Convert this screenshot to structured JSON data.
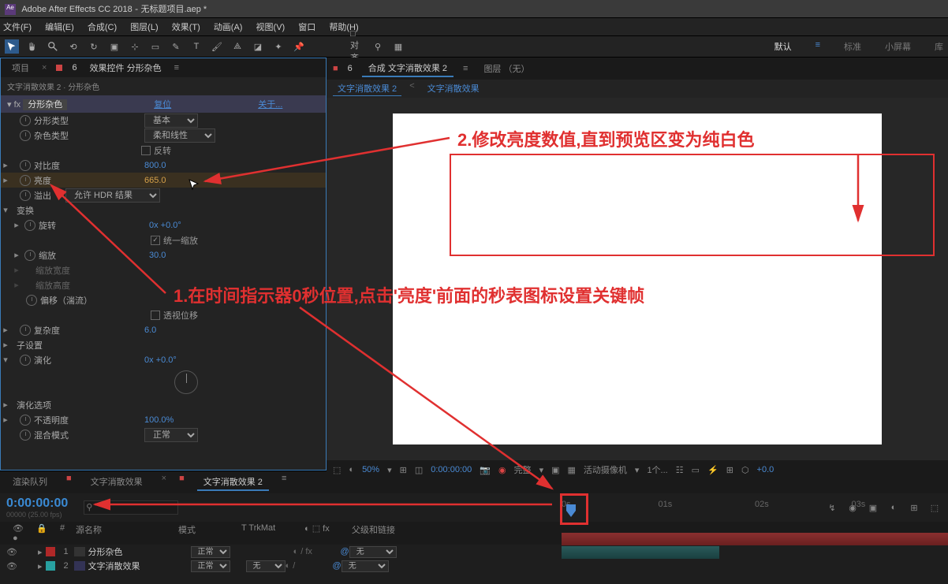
{
  "titlebar": {
    "app": "Adobe After Effects CC 2018",
    "project": "无标题项目.aep *"
  },
  "menu": [
    "文件(F)",
    "编辑(E)",
    "合成(C)",
    "图层(L)",
    "效果(T)",
    "动画(A)",
    "视图(V)",
    "窗口",
    "帮助(H)"
  ],
  "toolbar": {
    "snap": "□ 对齐"
  },
  "workspaces": [
    "默认",
    "标准",
    "小屏幕",
    "库"
  ],
  "leftPanel": {
    "tabs": {
      "project": "项目",
      "fx": "效果控件 分形杂色"
    },
    "breadcrumb": "文字消散效果 2 · 分形杂色",
    "fxHeader": {
      "name": "分形杂色",
      "reset": "复位",
      "about": "关于..."
    },
    "props": {
      "fractalType": {
        "label": "分形类型",
        "value": "基本"
      },
      "noiseType": {
        "label": "杂色类型",
        "value": "柔和线性"
      },
      "invert": {
        "label": "反转"
      },
      "contrast": {
        "label": "对比度",
        "value": "800.0"
      },
      "brightness": {
        "label": "亮度",
        "value": "665.0"
      },
      "overflow": {
        "label": "溢出",
        "value": "允许 HDR 结果"
      },
      "transform": {
        "label": "变换"
      },
      "rotation": {
        "label": "旋转",
        "value": "0x +0.0°"
      },
      "uniformScale": {
        "label": "统一缩放"
      },
      "scale": {
        "label": "缩放",
        "value": "30.0"
      },
      "scaleW": {
        "label": "缩放宽度",
        "value": ""
      },
      "scaleH": {
        "label": "缩放高度",
        "value": ""
      },
      "offset": {
        "label": "偏移（湍流）"
      },
      "perspective": {
        "label": "透视位移"
      },
      "complexity": {
        "label": "复杂度",
        "value": "6.0"
      },
      "sub": {
        "label": "子设置"
      },
      "evolution": {
        "label": "演化",
        "value": "0x +0.0°"
      },
      "evolOptions": {
        "label": "演化选项"
      },
      "opacity": {
        "label": "不透明度",
        "value": "100.0%"
      },
      "blend": {
        "label": "混合模式",
        "value": "正常"
      }
    }
  },
  "comp": {
    "tabs": {
      "comp": "合成 文字消散效果 2",
      "layer": "图层 （无）"
    },
    "subtabs": [
      "文字消散效果 2",
      "文字消散效果"
    ]
  },
  "viewerFooter": {
    "zoom": "50%",
    "time": "0:00:00:00",
    "full": "完整",
    "camera": "活动摄像机",
    "views": "1个...",
    "exposure": "+0.0"
  },
  "timeline": {
    "tabs": [
      "渲染队列",
      "文字消散效果",
      "文字消散效果 2"
    ],
    "timecode": "0:00:00:00",
    "fps": "00000 (25.00 fps)",
    "cols": {
      "source": "源名称",
      "mode": "模式",
      "trkmat": "T TrkMat",
      "parent": "父级和链接"
    },
    "layers": [
      {
        "num": "1",
        "name": "分形杂色",
        "mode": "正常",
        "parent": "无",
        "color": "#b02828"
      },
      {
        "num": "2",
        "name": "文字消散效果",
        "mode": "正常",
        "parent": "无",
        "color": "#28a0a0"
      }
    ],
    "ruler": [
      "0s",
      "01s",
      "02s",
      "03s"
    ]
  },
  "annotations": {
    "a1": "1.在时间指示器0秒位置,点击'亮度'前面的秒表图标设置关键帧",
    "a2": "2.修改亮度数值,直到预览区变为纯白色"
  }
}
